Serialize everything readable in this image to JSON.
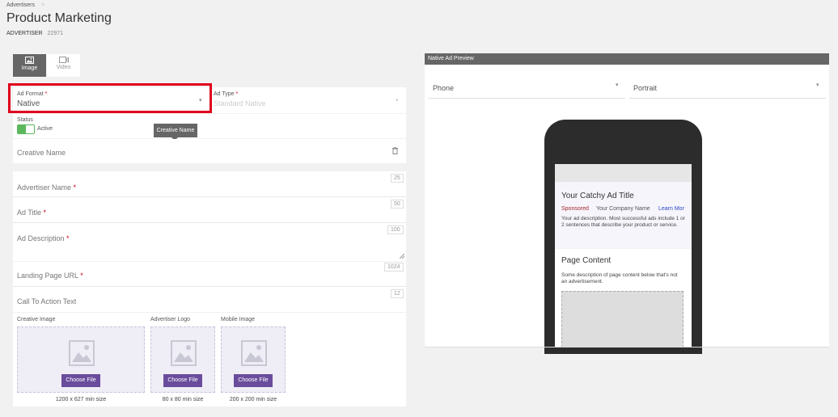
{
  "breadcrumb": {
    "parent": "Advertisers",
    "separator": ">"
  },
  "page": {
    "title": "Product Marketing",
    "advertiser_label": "ADVERTISER",
    "advertiser_id": "22971"
  },
  "tabs": [
    {
      "label": "Image",
      "icon": "image-icon",
      "active": true
    },
    {
      "label": "Video",
      "icon": "video-camera-icon",
      "active": false
    }
  ],
  "ad_format": {
    "label": "Ad Format",
    "required": "*",
    "value": "Native"
  },
  "ad_type": {
    "label": "Ad Type",
    "required": "*",
    "placeholder": "Standard Native"
  },
  "status": {
    "label": "Status",
    "value": "Active"
  },
  "tooltip": {
    "text": "Creative Name"
  },
  "fields": {
    "creative_name": {
      "placeholder": "Creative Name"
    },
    "advertiser_name": {
      "placeholder": "Advertiser Name",
      "required": "*",
      "limit": "25"
    },
    "ad_title": {
      "placeholder": "Ad Title",
      "required": "*",
      "limit": "50"
    },
    "ad_description": {
      "placeholder": "Ad Description",
      "required": "*",
      "limit": "100"
    },
    "landing_page_url": {
      "placeholder": "Landing Page URL",
      "required": "*",
      "limit": "1024"
    },
    "call_to_action": {
      "placeholder": "Call To Action Text",
      "limit": "12"
    }
  },
  "uploads": {
    "creative_image": {
      "label": "Creative Image",
      "button": "Choose File",
      "size": "1200 x 627 min size"
    },
    "advertiser_logo": {
      "label": "Advertiser Logo",
      "button": "Choose File",
      "size": "80 x 80 min size"
    },
    "mobile_image": {
      "label": "Mobile Image",
      "button": "Choose File",
      "size": "200 x 200 min size"
    }
  },
  "preview": {
    "header": "Native Ad Preview",
    "device": "Phone",
    "orientation": "Portrait",
    "ad_title": "Your Catchy Ad Title",
    "sponsored": "Sponsored",
    "company": "Your Company Name",
    "learn_more": "Learn Mor",
    "ad_description": "Your ad description. Most successful ads include 1 or 2 sentences that describe your product or service.",
    "page_content_title": "Page Content",
    "page_content_desc": "Some description of page content below that's not an advertisement."
  },
  "colors": {
    "accent_purple": "#6a4c9c",
    "toggle_green": "#5cb85c",
    "highlight_red": "#e0001b",
    "required_red": "#d0021b"
  }
}
